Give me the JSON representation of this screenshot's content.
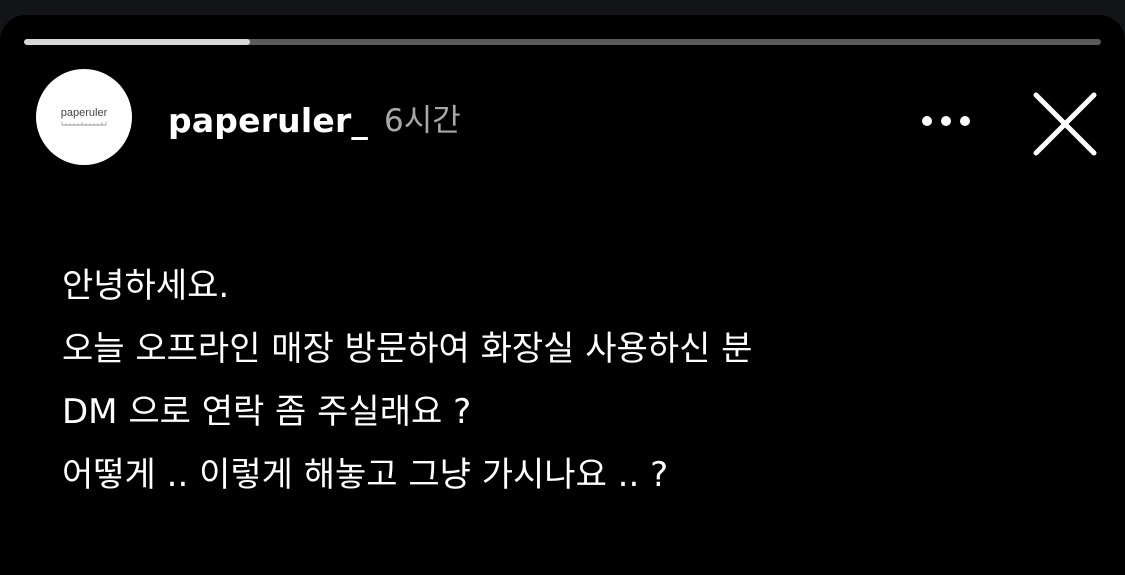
{
  "story": {
    "progress": 0.21,
    "colors": {
      "background": "#000000",
      "progress_track": "#5a5a5a",
      "progress_fill": "#d8d8d8",
      "username": "#ffffff",
      "time": "#a8a8a8"
    }
  },
  "header": {
    "avatar": {
      "logo_text": "paperuler"
    },
    "username": "paperuler_",
    "time_ago": "6시간",
    "more_icon": "more-horizontal-icon",
    "close_icon": "close-icon"
  },
  "message": {
    "lines": [
      "안녕하세요.",
      "오늘 오프라인 매장 방문하여 화장실 사용하신 분",
      "DM 으로 연락 좀 주실래요 ?",
      "어떻게 .. 이렇게 해놓고 그냥 가시나요 .. ?"
    ]
  }
}
